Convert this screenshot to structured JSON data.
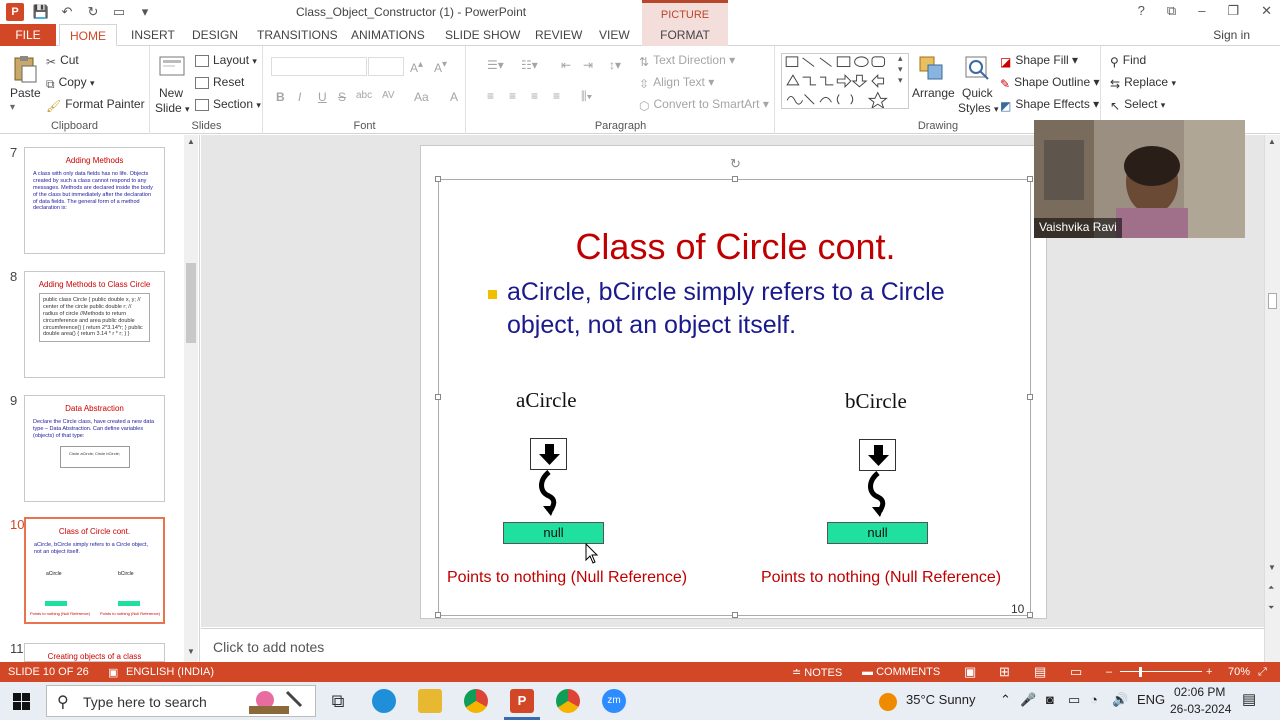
{
  "titlebar": {
    "document_title": "Class_Object_Constructor (1) - PowerPoint",
    "context_tools": "PICTURE TOOLS",
    "window_buttons": [
      "?",
      "⧉",
      "–",
      "❐",
      "✕"
    ]
  },
  "tabs": {
    "file": "FILE",
    "home": "HOME",
    "insert": "INSERT",
    "design": "DESIGN",
    "transitions": "TRANSITIONS",
    "animations": "ANIMATIONS",
    "slide_show": "SLIDE SHOW",
    "review": "REVIEW",
    "view": "VIEW",
    "format": "FORMAT",
    "sign_in": "Sign in"
  },
  "ribbon": {
    "clipboard": {
      "label": "Clipboard",
      "paste": "Paste",
      "cut": "Cut",
      "copy": "Copy",
      "format_painter": "Format Painter"
    },
    "slides": {
      "label": "Slides",
      "new_slide_1": "New",
      "new_slide_2": "Slide",
      "layout": "Layout",
      "reset": "Reset",
      "section": "Section"
    },
    "font": {
      "label": "Font",
      "bold": "B",
      "italic": "I",
      "underline": "U",
      "strike": "S",
      "shadow": "abc",
      "spacing": "AV",
      "case": "Aa",
      "color": "A"
    },
    "paragraph": {
      "label": "Paragraph",
      "text_direction": "Text Direction",
      "align_text": "Align Text",
      "convert_smartart": "Convert to SmartArt"
    },
    "drawing": {
      "label": "Drawing",
      "arrange": "Arrange",
      "quick_styles_1": "Quick",
      "quick_styles_2": "Styles",
      "shape_fill": "Shape Fill",
      "shape_outline": "Shape Outline",
      "shape_effects": "Shape Effects"
    },
    "editing": {
      "find": "Find",
      "replace": "Replace",
      "select": "Select"
    }
  },
  "thumbnails": [
    {
      "num": "7",
      "title": "Adding Methods",
      "body": "A class with only data fields has no life. Objects created by such a class cannot respond to any messages. Methods are declared inside the body of the class but immediately after the declaration of data fields. The general form of a method declaration is:"
    },
    {
      "num": "8",
      "title": "Adding Methods to Class Circle",
      "body": "public class Circle { public double x, y; // center of the circle public double r; // radius of circle //Methods to return circumference and area public double circumference() { return 2*3.14*r; } public double area() { return 3.14 * r * r; } }"
    },
    {
      "num": "9",
      "title": "Data Abstraction",
      "body": "Declare the Circle class, have created a new data type – Data Abstraction. Can define variables (objects) of that type:",
      "box": "Circle aCircle; Circle bCircle;"
    },
    {
      "num": "10",
      "title": "Class of Circle cont.",
      "body": "aCircle, bCircle simply refers to a Circle object, not an object itself."
    },
    {
      "num": "11",
      "title": "Creating objects of a class",
      "body": ""
    }
  ],
  "slide": {
    "title": "Class of Circle cont.",
    "bullet": "aCircle, bCircle simply refers to a Circle object, not an object itself.",
    "left_var": "aCircle",
    "right_var": "bCircle",
    "null_text": "null",
    "null_ref_text": "Points to nothing (Null Reference)",
    "number": "10"
  },
  "notes_placeholder": "Click to add notes",
  "webcam": {
    "name": "Vaishvika Ravi"
  },
  "statusbar": {
    "slide_info": "SLIDE 10 OF 26",
    "language": "ENGLISH (INDIA)",
    "notes": "NOTES",
    "comments": "COMMENTS",
    "zoom": "70%"
  },
  "taskbar": {
    "search_placeholder": "Type here to search",
    "weather": "35°C  Sunny",
    "lang": "ENG",
    "time": "02:06 PM",
    "date": "26-03-2024"
  },
  "colors": {
    "accent": "#d24726",
    "title_red": "#c00000",
    "bullet_blue": "#1a1a8c",
    "null_green": "#20e0a0"
  }
}
